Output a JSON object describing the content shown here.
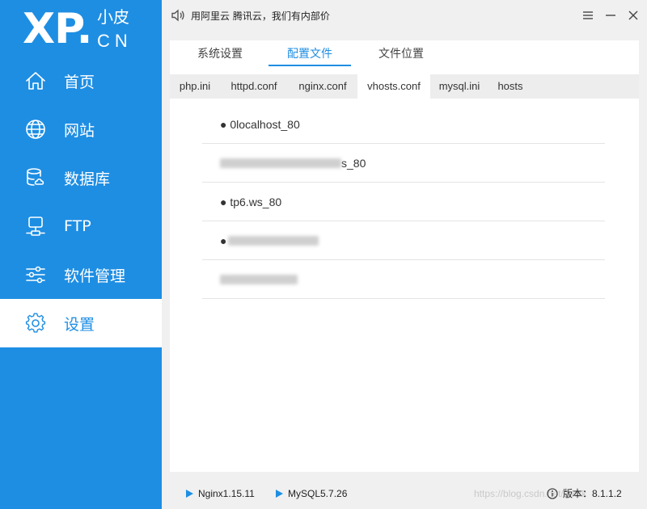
{
  "logo": {
    "main": "XP.",
    "small": "小皮",
    "cn": "CN"
  },
  "sidebar": {
    "items": [
      {
        "label": "首页",
        "icon": "home-icon"
      },
      {
        "label": "网站",
        "icon": "globe-icon"
      },
      {
        "label": "数据库",
        "icon": "database-icon"
      },
      {
        "label": "FTP",
        "icon": "ftp-icon"
      },
      {
        "label": "软件管理",
        "icon": "sliders-icon"
      },
      {
        "label": "设置",
        "icon": "gear-icon",
        "active": true
      }
    ]
  },
  "titlebar": {
    "notice": "用阿里云 腾讯云，我们有内部价"
  },
  "settings_tabs": [
    {
      "label": "系统设置"
    },
    {
      "label": "配置文件",
      "active": true
    },
    {
      "label": "文件位置"
    }
  ],
  "file_tabs": [
    {
      "label": "php.ini"
    },
    {
      "label": "httpd.conf"
    },
    {
      "label": "nginx.conf"
    },
    {
      "label": "vhosts.conf",
      "active": true
    },
    {
      "label": "mysql.ini"
    },
    {
      "label": "hosts"
    }
  ],
  "vhosts": [
    {
      "text": "● 0localhost_80"
    },
    {
      "text": "s_80"
    },
    {
      "text": "● tp6.ws_80"
    },
    {
      "text": "●"
    },
    {
      "text": ""
    }
  ],
  "status": {
    "nginx": "Nginx1.15.11",
    "mysql": "MySQL5.7.26",
    "watermark": "https://blog.csdn.net/...kak",
    "version": "版本：8.1.1.2"
  },
  "colors": {
    "accent": "#1e8ee3"
  }
}
